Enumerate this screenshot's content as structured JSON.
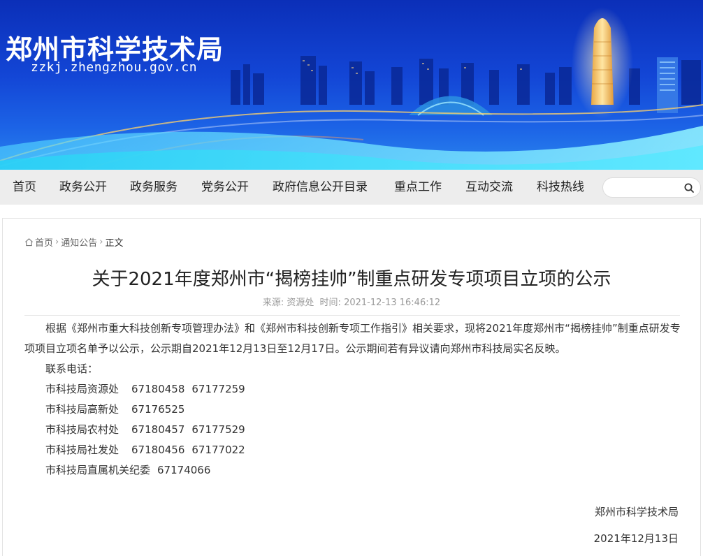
{
  "header": {
    "title": "郑州市科学技术局",
    "domain": "zzkj.zhengzhou.gov.cn"
  },
  "nav": {
    "items": [
      "首页",
      "政务公开",
      "政务服务",
      "党务公开",
      "政府信息公开目录",
      "重点工作",
      "互动交流",
      "科技热线"
    ],
    "search_placeholder": ""
  },
  "breadcrumb": {
    "home": "首页",
    "section": "通知公告",
    "current": "正文"
  },
  "article": {
    "title": "关于2021年度郑州市“揭榜挂帅”制重点研发专项项目立项的公示",
    "source_label": "来源:",
    "source": "资源处",
    "time_label": "时间:",
    "time": "2021-12-13 16:46:12",
    "paragraph": "根据《郑州市重大科技创新专项管理办法》和《郑州市科技创新专项工作指引》相关要求，现将2021年度郑州市“揭榜挂帅”制重点研发专项项目立项名单予以公示，公示期自2021年12月13日至12月17日。公示期间若有异议请向郑州市科技局实名反映。",
    "contact_label": "联系电话：",
    "contacts": [
      {
        "dept": "市科技局资源处",
        "phones": [
          "67180458",
          "67177259"
        ]
      },
      {
        "dept": "市科技局高新处",
        "phones": [
          "67176525"
        ]
      },
      {
        "dept": "市科技局农村处",
        "phones": [
          "67180457",
          "67177529"
        ]
      },
      {
        "dept": "市科技局社发处",
        "phones": [
          "67180456",
          "67177022"
        ]
      },
      {
        "dept": "市科技局直属机关纪委",
        "phones": [
          "67174066"
        ]
      }
    ],
    "signature": "郑州市科学技术局",
    "date": "2021年12月13日"
  },
  "colors": {
    "banner_dark": "#0b2fb8",
    "banner_light": "#2a86ef",
    "nav_bg": "#ededed",
    "tower_glow": "#ffd36b"
  },
  "icons": {
    "search": "search-icon",
    "home": "home-icon",
    "breadcrumb_sep": "chevron-right-icon"
  }
}
